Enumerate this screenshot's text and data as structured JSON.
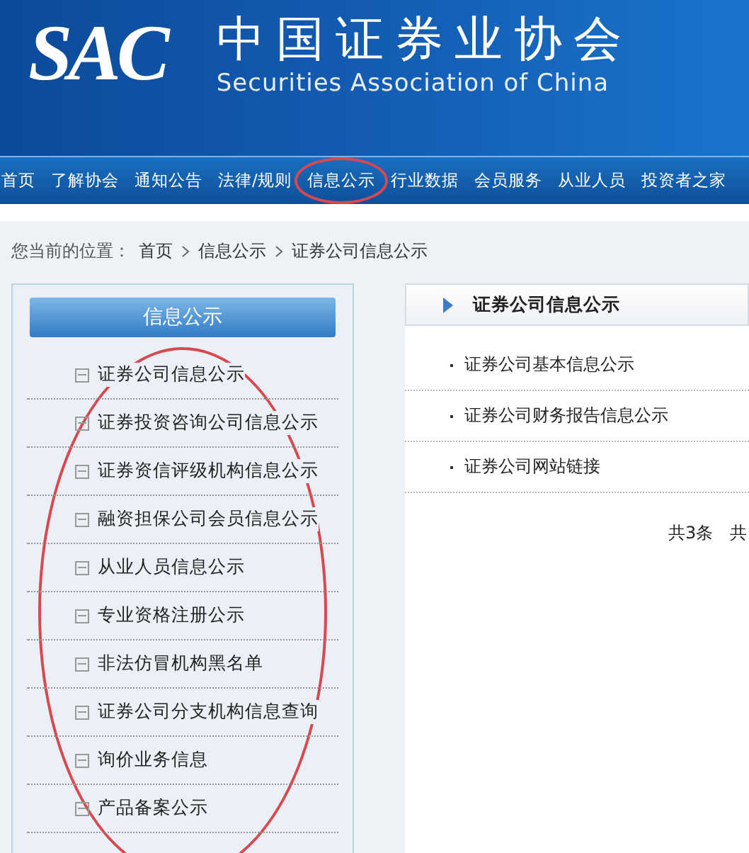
{
  "header": {
    "logo": "SAC",
    "title": "中国证券业协会",
    "subtitle": "Securities Association of China"
  },
  "nav": [
    {
      "label": "首页",
      "circled": false
    },
    {
      "label": "了解协会",
      "circled": false
    },
    {
      "label": "通知公告",
      "circled": false
    },
    {
      "label": "法律/规则",
      "circled": false
    },
    {
      "label": "信息公示",
      "circled": true
    },
    {
      "label": "行业数据",
      "circled": false
    },
    {
      "label": "会员服务",
      "circled": false
    },
    {
      "label": "从业人员",
      "circled": false
    },
    {
      "label": "投资者之家",
      "circled": false
    }
  ],
  "breadcrumb": {
    "prefix": "您当前的位置：",
    "items": [
      "首页",
      "信息公示",
      "证券公司信息公示"
    ]
  },
  "sidebar": {
    "title": "信息公示",
    "circled": true,
    "items": [
      "证券公司信息公示",
      "证券投资咨询公司信息公示",
      "证券资信评级机构信息公示",
      "融资担保公司会员信息公示",
      "从业人员信息公示",
      "专业资格注册公示",
      "非法仿冒机构黑名单",
      "证券公司分支机构信息查询",
      "询价业务信息",
      "产品备案公示"
    ]
  },
  "content": {
    "title": "证券公司信息公示",
    "items": [
      "证券公司基本信息公示",
      "证券公司财务报告信息公示",
      "证券公司网站链接"
    ],
    "pagination": [
      "共3条",
      "共"
    ]
  }
}
